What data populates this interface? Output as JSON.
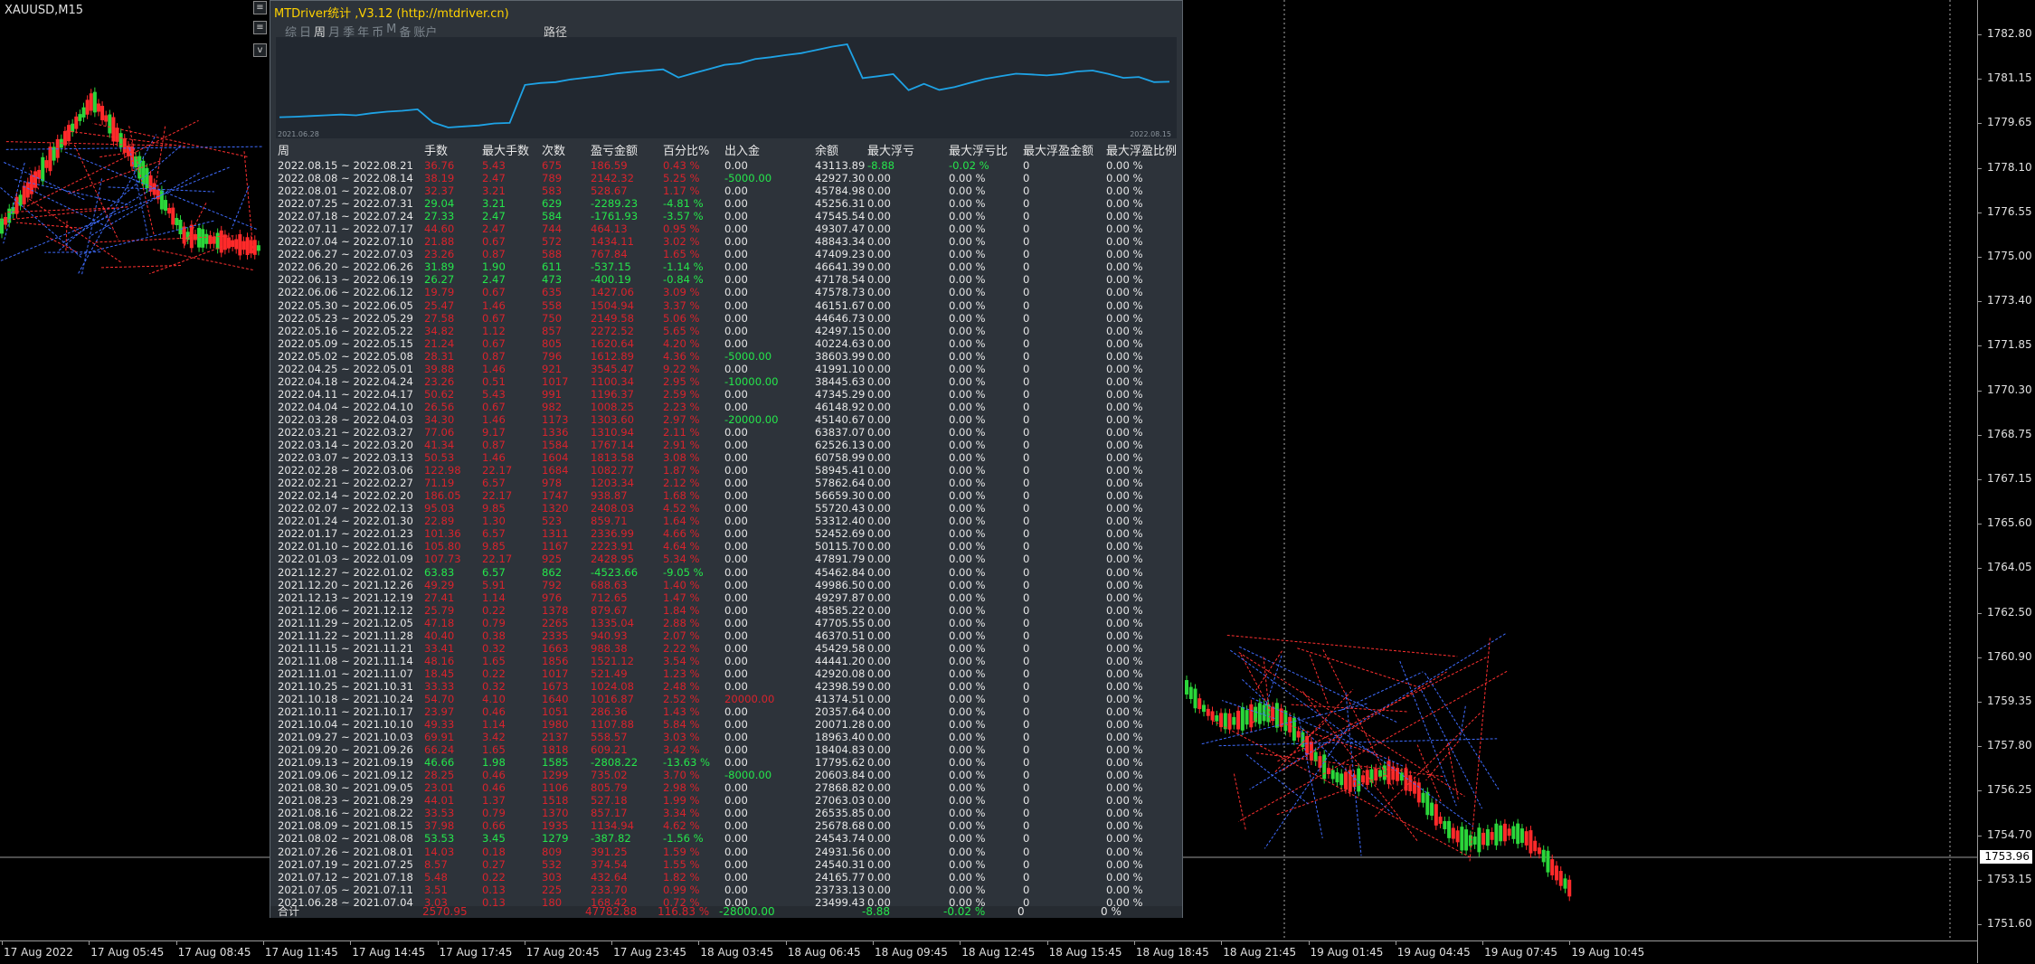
{
  "chart": {
    "symbol": "XAUUSD,M15",
    "current_price": "1753.96",
    "price_ticks": [
      "1782.80",
      "1781.15",
      "1779.65",
      "1778.10",
      "1776.55",
      "1775.00",
      "1773.40",
      "1771.85",
      "1770.30",
      "1768.75",
      "1767.15",
      "1765.60",
      "1764.05",
      "1762.50",
      "1760.90",
      "1759.35",
      "1757.80",
      "1756.25",
      "1754.70",
      "1753.15",
      "1751.60"
    ],
    "time_ticks": [
      "17 Aug 2022",
      "17 Aug 05:45",
      "17 Aug 08:45",
      "17 Aug 11:45",
      "17 Aug 14:45",
      "17 Aug 17:45",
      "17 Aug 20:45",
      "17 Aug 23:45",
      "18 Aug 03:45",
      "18 Aug 06:45",
      "18 Aug 09:45",
      "18 Aug 12:45",
      "18 Aug 15:45",
      "18 Aug 18:45",
      "18 Aug 21:45",
      "19 Aug 01:45",
      "19 Aug 04:45",
      "19 Aug 07:45",
      "19 Aug 10:45"
    ],
    "buttons": [
      "≡",
      "≡",
      "v"
    ]
  },
  "panel": {
    "title": "MTDriver统计 ,V3.12 (http://mtdriver.cn)",
    "tabs": [
      "综",
      "日",
      "周",
      "月",
      "季",
      "年",
      "币",
      "M",
      "备",
      "账户"
    ],
    "active_tab": "周",
    "path_label": "路径",
    "mini_chart": {
      "start_date": "2021.06.28",
      "end_date": "2022.08.15",
      "line_color": "#1ea3e6"
    },
    "headers": [
      "周",
      "手数",
      "最大手数",
      "次数",
      "盈亏金额",
      "百分比%",
      "出入金",
      "余额",
      "最大浮亏",
      "最大浮亏比",
      "最大浮盈金额",
      "最大浮盈比例"
    ],
    "rows": [
      [
        "2022.08.15 ~ 2022.08.21",
        "36.76",
        "5.43",
        "675",
        "186.59",
        "0.43 %",
        "0.00",
        "43113.89",
        "-8.88",
        "-0.02 %",
        "0",
        "0.00 %"
      ],
      [
        "2022.08.08 ~ 2022.08.14",
        "38.19",
        "2.47",
        "789",
        "2142.32",
        "5.25 %",
        "-5000.00",
        "42927.30",
        "0.00",
        "0.00 %",
        "0",
        "0.00 %"
      ],
      [
        "2022.08.01 ~ 2022.08.07",
        "32.37",
        "3.21",
        "583",
        "528.67",
        "1.17 %",
        "0.00",
        "45784.98",
        "0.00",
        "0.00 %",
        "0",
        "0.00 %"
      ],
      [
        "2022.07.25 ~ 2022.07.31",
        "29.04",
        "3.21",
        "629",
        "-2289.23",
        "-4.81 %",
        "0.00",
        "45256.31",
        "0.00",
        "0.00 %",
        "0",
        "0.00 %"
      ],
      [
        "2022.07.18 ~ 2022.07.24",
        "27.33",
        "2.47",
        "584",
        "-1761.93",
        "-3.57 %",
        "0.00",
        "47545.54",
        "0.00",
        "0.00 %",
        "0",
        "0.00 %"
      ],
      [
        "2022.07.11 ~ 2022.07.17",
        "44.60",
        "2.47",
        "744",
        "464.13",
        "0.95 %",
        "0.00",
        "49307.47",
        "0.00",
        "0.00 %",
        "0",
        "0.00 %"
      ],
      [
        "2022.07.04 ~ 2022.07.10",
        "21.88",
        "0.67",
        "572",
        "1434.11",
        "3.02 %",
        "0.00",
        "48843.34",
        "0.00",
        "0.00 %",
        "0",
        "0.00 %"
      ],
      [
        "2022.06.27 ~ 2022.07.03",
        "23.26",
        "0.87",
        "588",
        "767.84",
        "1.65 %",
        "0.00",
        "47409.23",
        "0.00",
        "0.00 %",
        "0",
        "0.00 %"
      ],
      [
        "2022.06.20 ~ 2022.06.26",
        "31.89",
        "1.90",
        "611",
        "-537.15",
        "-1.14 %",
        "0.00",
        "46641.39",
        "0.00",
        "0.00 %",
        "0",
        "0.00 %"
      ],
      [
        "2022.06.13 ~ 2022.06.19",
        "26.27",
        "2.47",
        "473",
        "-400.19",
        "-0.84 %",
        "0.00",
        "47178.54",
        "0.00",
        "0.00 %",
        "0",
        "0.00 %"
      ],
      [
        "2022.06.06 ~ 2022.06.12",
        "19.79",
        "0.67",
        "635",
        "1427.06",
        "3.09 %",
        "0.00",
        "47578.73",
        "0.00",
        "0.00 %",
        "0",
        "0.00 %"
      ],
      [
        "2022.05.30 ~ 2022.06.05",
        "25.47",
        "1.46",
        "558",
        "1504.94",
        "3.37 %",
        "0.00",
        "46151.67",
        "0.00",
        "0.00 %",
        "0",
        "0.00 %"
      ],
      [
        "2022.05.23 ~ 2022.05.29",
        "27.58",
        "0.67",
        "750",
        "2149.58",
        "5.06 %",
        "0.00",
        "44646.73",
        "0.00",
        "0.00 %",
        "0",
        "0.00 %"
      ],
      [
        "2022.05.16 ~ 2022.05.22",
        "34.82",
        "1.12",
        "857",
        "2272.52",
        "5.65 %",
        "0.00",
        "42497.15",
        "0.00",
        "0.00 %",
        "0",
        "0.00 %"
      ],
      [
        "2022.05.09 ~ 2022.05.15",
        "21.24",
        "0.67",
        "805",
        "1620.64",
        "4.20 %",
        "0.00",
        "40224.63",
        "0.00",
        "0.00 %",
        "0",
        "0.00 %"
      ],
      [
        "2022.05.02 ~ 2022.05.08",
        "28.31",
        "0.87",
        "796",
        "1612.89",
        "4.36 %",
        "-5000.00",
        "38603.99",
        "0.00",
        "0.00 %",
        "0",
        "0.00 %"
      ],
      [
        "2022.04.25 ~ 2022.05.01",
        "39.88",
        "1.46",
        "921",
        "3545.47",
        "9.22 %",
        "0.00",
        "41991.10",
        "0.00",
        "0.00 %",
        "0",
        "0.00 %"
      ],
      [
        "2022.04.18 ~ 2022.04.24",
        "23.26",
        "0.51",
        "1017",
        "1100.34",
        "2.95 %",
        "-10000.00",
        "38445.63",
        "0.00",
        "0.00 %",
        "0",
        "0.00 %"
      ],
      [
        "2022.04.11 ~ 2022.04.17",
        "50.62",
        "5.43",
        "991",
        "1196.37",
        "2.59 %",
        "0.00",
        "47345.29",
        "0.00",
        "0.00 %",
        "0",
        "0.00 %"
      ],
      [
        "2022.04.04 ~ 2022.04.10",
        "26.56",
        "0.67",
        "982",
        "1008.25",
        "2.23 %",
        "0.00",
        "46148.92",
        "0.00",
        "0.00 %",
        "0",
        "0.00 %"
      ],
      [
        "2022.03.28 ~ 2022.04.03",
        "34.30",
        "1.46",
        "1173",
        "1303.60",
        "2.97 %",
        "-20000.00",
        "45140.67",
        "0.00",
        "0.00 %",
        "0",
        "0.00 %"
      ],
      [
        "2022.03.21 ~ 2022.03.27",
        "77.06",
        "9.17",
        "1336",
        "1310.94",
        "2.11 %",
        "0.00",
        "63837.07",
        "0.00",
        "0.00 %",
        "0",
        "0.00 %"
      ],
      [
        "2022.03.14 ~ 2022.03.20",
        "41.34",
        "0.87",
        "1584",
        "1767.14",
        "2.91 %",
        "0.00",
        "62526.13",
        "0.00",
        "0.00 %",
        "0",
        "0.00 %"
      ],
      [
        "2022.03.07 ~ 2022.03.13",
        "50.53",
        "1.46",
        "1604",
        "1813.58",
        "3.08 %",
        "0.00",
        "60758.99",
        "0.00",
        "0.00 %",
        "0",
        "0.00 %"
      ],
      [
        "2022.02.28 ~ 2022.03.06",
        "122.98",
        "22.17",
        "1684",
        "1082.77",
        "1.87 %",
        "0.00",
        "58945.41",
        "0.00",
        "0.00 %",
        "0",
        "0.00 %"
      ],
      [
        "2022.02.21 ~ 2022.02.27",
        "71.19",
        "6.57",
        "978",
        "1203.34",
        "2.12 %",
        "0.00",
        "57862.64",
        "0.00",
        "0.00 %",
        "0",
        "0.00 %"
      ],
      [
        "2022.02.14 ~ 2022.02.20",
        "186.05",
        "22.17",
        "1747",
        "938.87",
        "1.68 %",
        "0.00",
        "56659.30",
        "0.00",
        "0.00 %",
        "0",
        "0.00 %"
      ],
      [
        "2022.02.07 ~ 2022.02.13",
        "95.03",
        "9.85",
        "1320",
        "2408.03",
        "4.52 %",
        "0.00",
        "55720.43",
        "0.00",
        "0.00 %",
        "0",
        "0.00 %"
      ],
      [
        "2022.01.24 ~ 2022.01.30",
        "22.89",
        "1.30",
        "523",
        "859.71",
        "1.64 %",
        "0.00",
        "53312.40",
        "0.00",
        "0.00 %",
        "0",
        "0.00 %"
      ],
      [
        "2022.01.17 ~ 2022.01.23",
        "101.36",
        "6.57",
        "1311",
        "2336.99",
        "4.66 %",
        "0.00",
        "52452.69",
        "0.00",
        "0.00 %",
        "0",
        "0.00 %"
      ],
      [
        "2022.01.10 ~ 2022.01.16",
        "105.80",
        "9.85",
        "1167",
        "2223.91",
        "4.64 %",
        "0.00",
        "50115.70",
        "0.00",
        "0.00 %",
        "0",
        "0.00 %"
      ],
      [
        "2022.01.03 ~ 2022.01.09",
        "107.73",
        "22.17",
        "925",
        "2428.95",
        "5.34 %",
        "0.00",
        "47891.79",
        "0.00",
        "0.00 %",
        "0",
        "0.00 %"
      ],
      [
        "2021.12.27 ~ 2022.01.02",
        "63.83",
        "6.57",
        "862",
        "-4523.66",
        "-9.05 %",
        "0.00",
        "45462.84",
        "0.00",
        "0.00 %",
        "0",
        "0.00 %"
      ],
      [
        "2021.12.20 ~ 2021.12.26",
        "49.29",
        "5.91",
        "792",
        "688.63",
        "1.40 %",
        "0.00",
        "49986.50",
        "0.00",
        "0.00 %",
        "0",
        "0.00 %"
      ],
      [
        "2021.12.13 ~ 2021.12.19",
        "27.41",
        "1.14",
        "976",
        "712.65",
        "1.47 %",
        "0.00",
        "49297.87",
        "0.00",
        "0.00 %",
        "0",
        "0.00 %"
      ],
      [
        "2021.12.06 ~ 2021.12.12",
        "25.79",
        "0.22",
        "1378",
        "879.67",
        "1.84 %",
        "0.00",
        "48585.22",
        "0.00",
        "0.00 %",
        "0",
        "0.00 %"
      ],
      [
        "2021.11.29 ~ 2021.12.05",
        "47.18",
        "0.79",
        "2265",
        "1335.04",
        "2.88 %",
        "0.00",
        "47705.55",
        "0.00",
        "0.00 %",
        "0",
        "0.00 %"
      ],
      [
        "2021.11.22 ~ 2021.11.28",
        "40.40",
        "0.38",
        "2335",
        "940.93",
        "2.07 %",
        "0.00",
        "46370.51",
        "0.00",
        "0.00 %",
        "0",
        "0.00 %"
      ],
      [
        "2021.11.15 ~ 2021.11.21",
        "33.41",
        "0.32",
        "1663",
        "988.38",
        "2.22 %",
        "0.00",
        "45429.58",
        "0.00",
        "0.00 %",
        "0",
        "0.00 %"
      ],
      [
        "2021.11.08 ~ 2021.11.14",
        "48.16",
        "1.65",
        "1856",
        "1521.12",
        "3.54 %",
        "0.00",
        "44441.20",
        "0.00",
        "0.00 %",
        "0",
        "0.00 %"
      ],
      [
        "2021.11.01 ~ 2021.11.07",
        "18.45",
        "0.22",
        "1017",
        "521.49",
        "1.23 %",
        "0.00",
        "42920.08",
        "0.00",
        "0.00 %",
        "0",
        "0.00 %"
      ],
      [
        "2021.10.25 ~ 2021.10.31",
        "33.33",
        "0.32",
        "1673",
        "1024.08",
        "2.48 %",
        "0.00",
        "42398.59",
        "0.00",
        "0.00 %",
        "0",
        "0.00 %"
      ],
      [
        "2021.10.18 ~ 2021.10.24",
        "54.70",
        "4.10",
        "1640",
        "1016.87",
        "2.52 %",
        "20000.00",
        "41374.51",
        "0.00",
        "0.00 %",
        "0",
        "0.00 %"
      ],
      [
        "2021.10.11 ~ 2021.10.17",
        "23.97",
        "0.46",
        "1051",
        "286.36",
        "1.43 %",
        "0.00",
        "20357.64",
        "0.00",
        "0.00 %",
        "0",
        "0.00 %"
      ],
      [
        "2021.10.04 ~ 2021.10.10",
        "49.33",
        "1.14",
        "1980",
        "1107.88",
        "5.84 %",
        "0.00",
        "20071.28",
        "0.00",
        "0.00 %",
        "0",
        "0.00 %"
      ],
      [
        "2021.09.27 ~ 2021.10.03",
        "69.91",
        "3.42",
        "2137",
        "558.57",
        "3.03 %",
        "0.00",
        "18963.40",
        "0.00",
        "0.00 %",
        "0",
        "0.00 %"
      ],
      [
        "2021.09.20 ~ 2021.09.26",
        "66.24",
        "1.65",
        "1818",
        "609.21",
        "3.42 %",
        "0.00",
        "18404.83",
        "0.00",
        "0.00 %",
        "0",
        "0.00 %"
      ],
      [
        "2021.09.13 ~ 2021.09.19",
        "46.66",
        "1.98",
        "1585",
        "-2808.22",
        "-13.63 %",
        "0.00",
        "17795.62",
        "0.00",
        "0.00 %",
        "0",
        "0.00 %"
      ],
      [
        "2021.09.06 ~ 2021.09.12",
        "28.25",
        "0.46",
        "1299",
        "735.02",
        "3.70 %",
        "-8000.00",
        "20603.84",
        "0.00",
        "0.00 %",
        "0",
        "0.00 %"
      ],
      [
        "2021.08.30 ~ 2021.09.05",
        "23.01",
        "0.46",
        "1106",
        "805.79",
        "2.98 %",
        "0.00",
        "27868.82",
        "0.00",
        "0.00 %",
        "0",
        "0.00 %"
      ],
      [
        "2021.08.23 ~ 2021.08.29",
        "44.01",
        "1.37",
        "1518",
        "527.18",
        "1.99 %",
        "0.00",
        "27063.03",
        "0.00",
        "0.00 %",
        "0",
        "0.00 %"
      ],
      [
        "2021.08.16 ~ 2021.08.22",
        "33.53",
        "0.79",
        "1370",
        "857.17",
        "3.34 %",
        "0.00",
        "26535.85",
        "0.00",
        "0.00 %",
        "0",
        "0.00 %"
      ],
      [
        "2021.08.09 ~ 2021.08.15",
        "37.98",
        "0.66",
        "1935",
        "1134.94",
        "4.62 %",
        "0.00",
        "25678.68",
        "0.00",
        "0.00 %",
        "0",
        "0.00 %"
      ],
      [
        "2021.08.02 ~ 2021.08.08",
        "53.53",
        "3.45",
        "1279",
        "-387.82",
        "-1.56 %",
        "0.00",
        "24543.74",
        "0.00",
        "0.00 %",
        "0",
        "0.00 %"
      ],
      [
        "2021.07.26 ~ 2021.08.01",
        "14.03",
        "0.18",
        "809",
        "391.25",
        "1.59 %",
        "0.00",
        "24931.56",
        "0.00",
        "0.00 %",
        "0",
        "0.00 %"
      ],
      [
        "2021.07.19 ~ 2021.07.25",
        "8.57",
        "0.27",
        "532",
        "374.54",
        "1.55 %",
        "0.00",
        "24540.31",
        "0.00",
        "0.00 %",
        "0",
        "0.00 %"
      ],
      [
        "2021.07.12 ~ 2021.07.18",
        "5.48",
        "0.22",
        "303",
        "432.64",
        "1.82 %",
        "0.00",
        "24165.77",
        "0.00",
        "0.00 %",
        "0",
        "0.00 %"
      ],
      [
        "2021.07.05 ~ 2021.07.11",
        "3.51",
        "0.13",
        "225",
        "233.70",
        "0.99 %",
        "0.00",
        "23733.13",
        "0.00",
        "0.00 %",
        "0",
        "0.00 %"
      ],
      [
        "2021.06.28 ~ 2021.07.04",
        "3.03",
        "0.13",
        "180",
        "168.42",
        "0.72 %",
        "0.00",
        "23499.43",
        "0.00",
        "0.00 %",
        "0",
        "0.00 %"
      ]
    ],
    "total": {
      "label": "合计",
      "lots": "2570.95",
      "pnl": "47782.88",
      "pct": "116.83 %",
      "flow": "-28000.00",
      "max_float_loss": "-8.88",
      "max_float_loss_pct": "-0.02 %",
      "max_float_gain": "0",
      "max_float_gain_pct": "0 %"
    },
    "colors": {
      "positive": "#d8232c",
      "negative": "#25e64b",
      "text": "#e6e6e6"
    }
  }
}
